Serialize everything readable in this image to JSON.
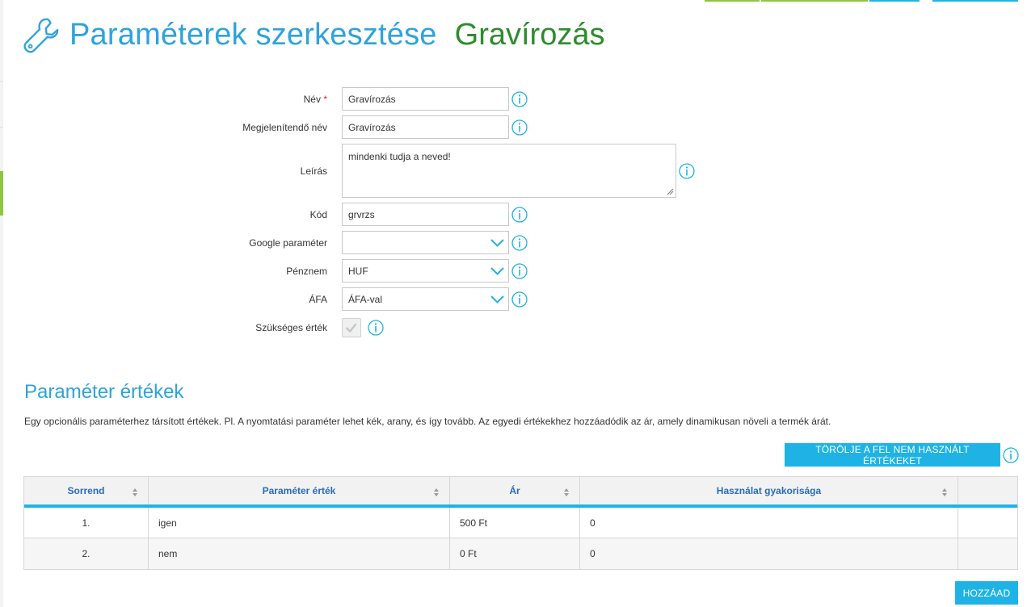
{
  "header": {
    "title": "Paraméterek szerkesztése",
    "subtitle": "Gravírozás"
  },
  "form": {
    "name_label": "Név",
    "name_required": "*",
    "name_value": "Gravírozás",
    "display_name_label": "Megjelenítendő név",
    "display_name_value": "Gravírozás",
    "description_label": "Leírás",
    "description_value": "mindenki tudja a neved!",
    "code_label": "Kód",
    "code_value": "grvrzs",
    "google_label": "Google paraméter",
    "google_value": "",
    "currency_label": "Pénznem",
    "currency_value": "HUF",
    "vat_label": "ÁFA",
    "vat_value": "ÁFA-val",
    "required_label": "Szükséges érték"
  },
  "values_section": {
    "title": "Paraméter értékek",
    "description": "Egy opcionális paraméterhez társított értékek. Pl. A nyomtatási paraméter lehet kék, arany, és így tovább. Az egyedi értékekhez hozzáadódik az ár, amely dinamikusan növeli a termék árát.",
    "delete_unused_label": "TÖRÖLJE A FEL NEM HASZNÁLT ÉRTÉKEKET",
    "add_label": "HOZZÁAD"
  },
  "table": {
    "columns": [
      "Sorrend",
      "Paraméter érték",
      "Ár",
      "Használat gyakorisága",
      ""
    ],
    "rows": [
      [
        "1.",
        "igen",
        "500 Ft",
        "0",
        ""
      ],
      [
        "2.",
        "nem",
        "0 Ft",
        "0",
        ""
      ]
    ]
  },
  "colors": {
    "accent": "#1fb3e5",
    "title_blue": "#2ea3db",
    "subtitle_green": "#2e8b2e",
    "required_red": "#d9242a",
    "left_marker_green": "#8dc63f"
  },
  "icons": {
    "header": "wrench-icon",
    "info": "info-icon",
    "select": "chevron-down-icon",
    "sort": "sort-icon",
    "check": "checkmark-icon"
  }
}
